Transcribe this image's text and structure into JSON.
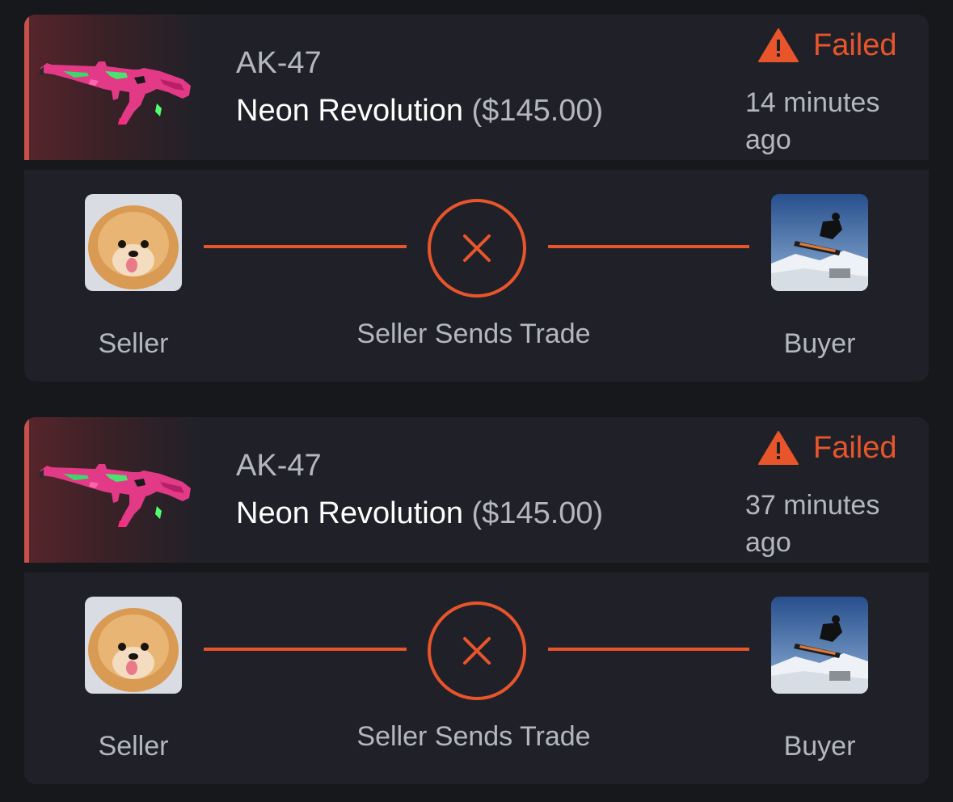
{
  "colors": {
    "background": "#17181c",
    "card": "#202128",
    "accent_failed": "#e8552b",
    "rarity_bar": "#c9514c",
    "muted_text": "#b4b7be",
    "primary_text": "#ffffff"
  },
  "trades": [
    {
      "weapon": "AK-47",
      "skin": "Neon Revolution",
      "price": "($145.00)",
      "item_icon": "ak47-neon-revolution-image",
      "status_icon": "warning-triangle-icon",
      "status": "Failed",
      "time_ago": "14 minutes ago",
      "seller": {
        "label": "Seller",
        "avatar": "pomeranian-dog-avatar"
      },
      "step": {
        "label": "Seller Sends Trade",
        "icon": "close-x-icon",
        "state": "failed"
      },
      "buyer": {
        "label": "Buyer",
        "avatar": "snowboarder-avatar"
      }
    },
    {
      "weapon": "AK-47",
      "skin": "Neon Revolution",
      "price": "($145.00)",
      "item_icon": "ak47-neon-revolution-image",
      "status_icon": "warning-triangle-icon",
      "status": "Failed",
      "time_ago": "37 minutes ago",
      "seller": {
        "label": "Seller",
        "avatar": "pomeranian-dog-avatar"
      },
      "step": {
        "label": "Seller Sends Trade",
        "icon": "close-x-icon",
        "state": "failed"
      },
      "buyer": {
        "label": "Buyer",
        "avatar": "snowboarder-avatar"
      }
    }
  ]
}
